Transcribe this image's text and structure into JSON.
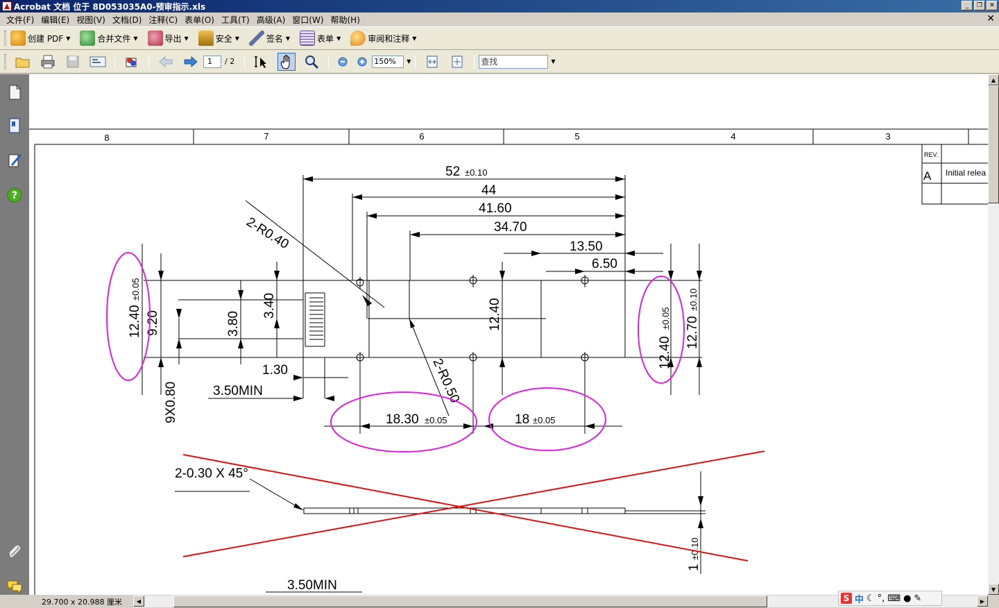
{
  "window": {
    "title": "Acrobat 文档 位于 8D053035A0-预审指示.xls",
    "controls": [
      "_",
      "❐",
      "✕"
    ]
  },
  "menu": [
    "文件(F)",
    "编辑(E)",
    "视图(V)",
    "文档(D)",
    "注释(C)",
    "表单(O)",
    "工具(T)",
    "高级(A)",
    "窗口(W)",
    "帮助(H)"
  ],
  "doc_close": "✕",
  "toolbar1": [
    {
      "label": "创建 PDF",
      "icon": "create-pdf-icon",
      "color": "#e8a020"
    },
    {
      "label": "合并文件",
      "icon": "combine-files-icon",
      "color": "#3a9a3a"
    },
    {
      "label": "导出",
      "icon": "export-icon",
      "color": "#c04060"
    },
    {
      "label": "安全",
      "icon": "lock-icon",
      "color": "#c09020"
    },
    {
      "label": "签名",
      "icon": "sign-pen-icon",
      "color": "#6070a0"
    },
    {
      "label": "表单",
      "icon": "form-icon",
      "color": "#6050a0"
    },
    {
      "label": "审阅和注释",
      "icon": "review-comment-icon",
      "color": "#e0a030"
    }
  ],
  "toolbar2": {
    "page_current": "1",
    "page_total": "/ 2",
    "zoom": "150%",
    "search_placeholder": "查找"
  },
  "status": {
    "page_size": "29.700 x 20.988 厘米"
  },
  "ime": {
    "brand": "S",
    "mode": "中",
    "icons": [
      "moon-icon",
      "punctuation-icon",
      "keyboard-icon",
      "user-icon",
      "wrench-icon"
    ]
  },
  "drawing": {
    "zones": [
      "8",
      "7",
      "6",
      "5",
      "4",
      "3"
    ],
    "title_block": {
      "rev_label": "REV.",
      "rev": "A",
      "desc": "Initial relea"
    },
    "dims": {
      "d52": "52",
      "t52": "±0.10",
      "d44": "44",
      "d4160": "41.60",
      "d3470": "34.70",
      "d1350": "13.50",
      "d650": "6.50",
      "r040": "2-R0.40",
      "r050": "2-R0.50",
      "d1240a": "12.40",
      "t1240a": "±0.05",
      "d920": "9.20",
      "d380": "3.80",
      "d340": "3.40",
      "d1240b": "12.40",
      "d1240c": "12.40",
      "t1240c": "±0.05",
      "d1270": "12.70",
      "t1270": "±0.10",
      "d130": "1.30",
      "d350min": "3.50MIN",
      "d9x080": "9X0.80",
      "d1830": "18.30",
      "t1830": "±0.05",
      "d18": "18",
      "t18": "±0.05",
      "chamfer": "2-0.30 X 45°",
      "d1": "1",
      "t1": "±0.10",
      "d350min2": "3.50MIN"
    }
  }
}
